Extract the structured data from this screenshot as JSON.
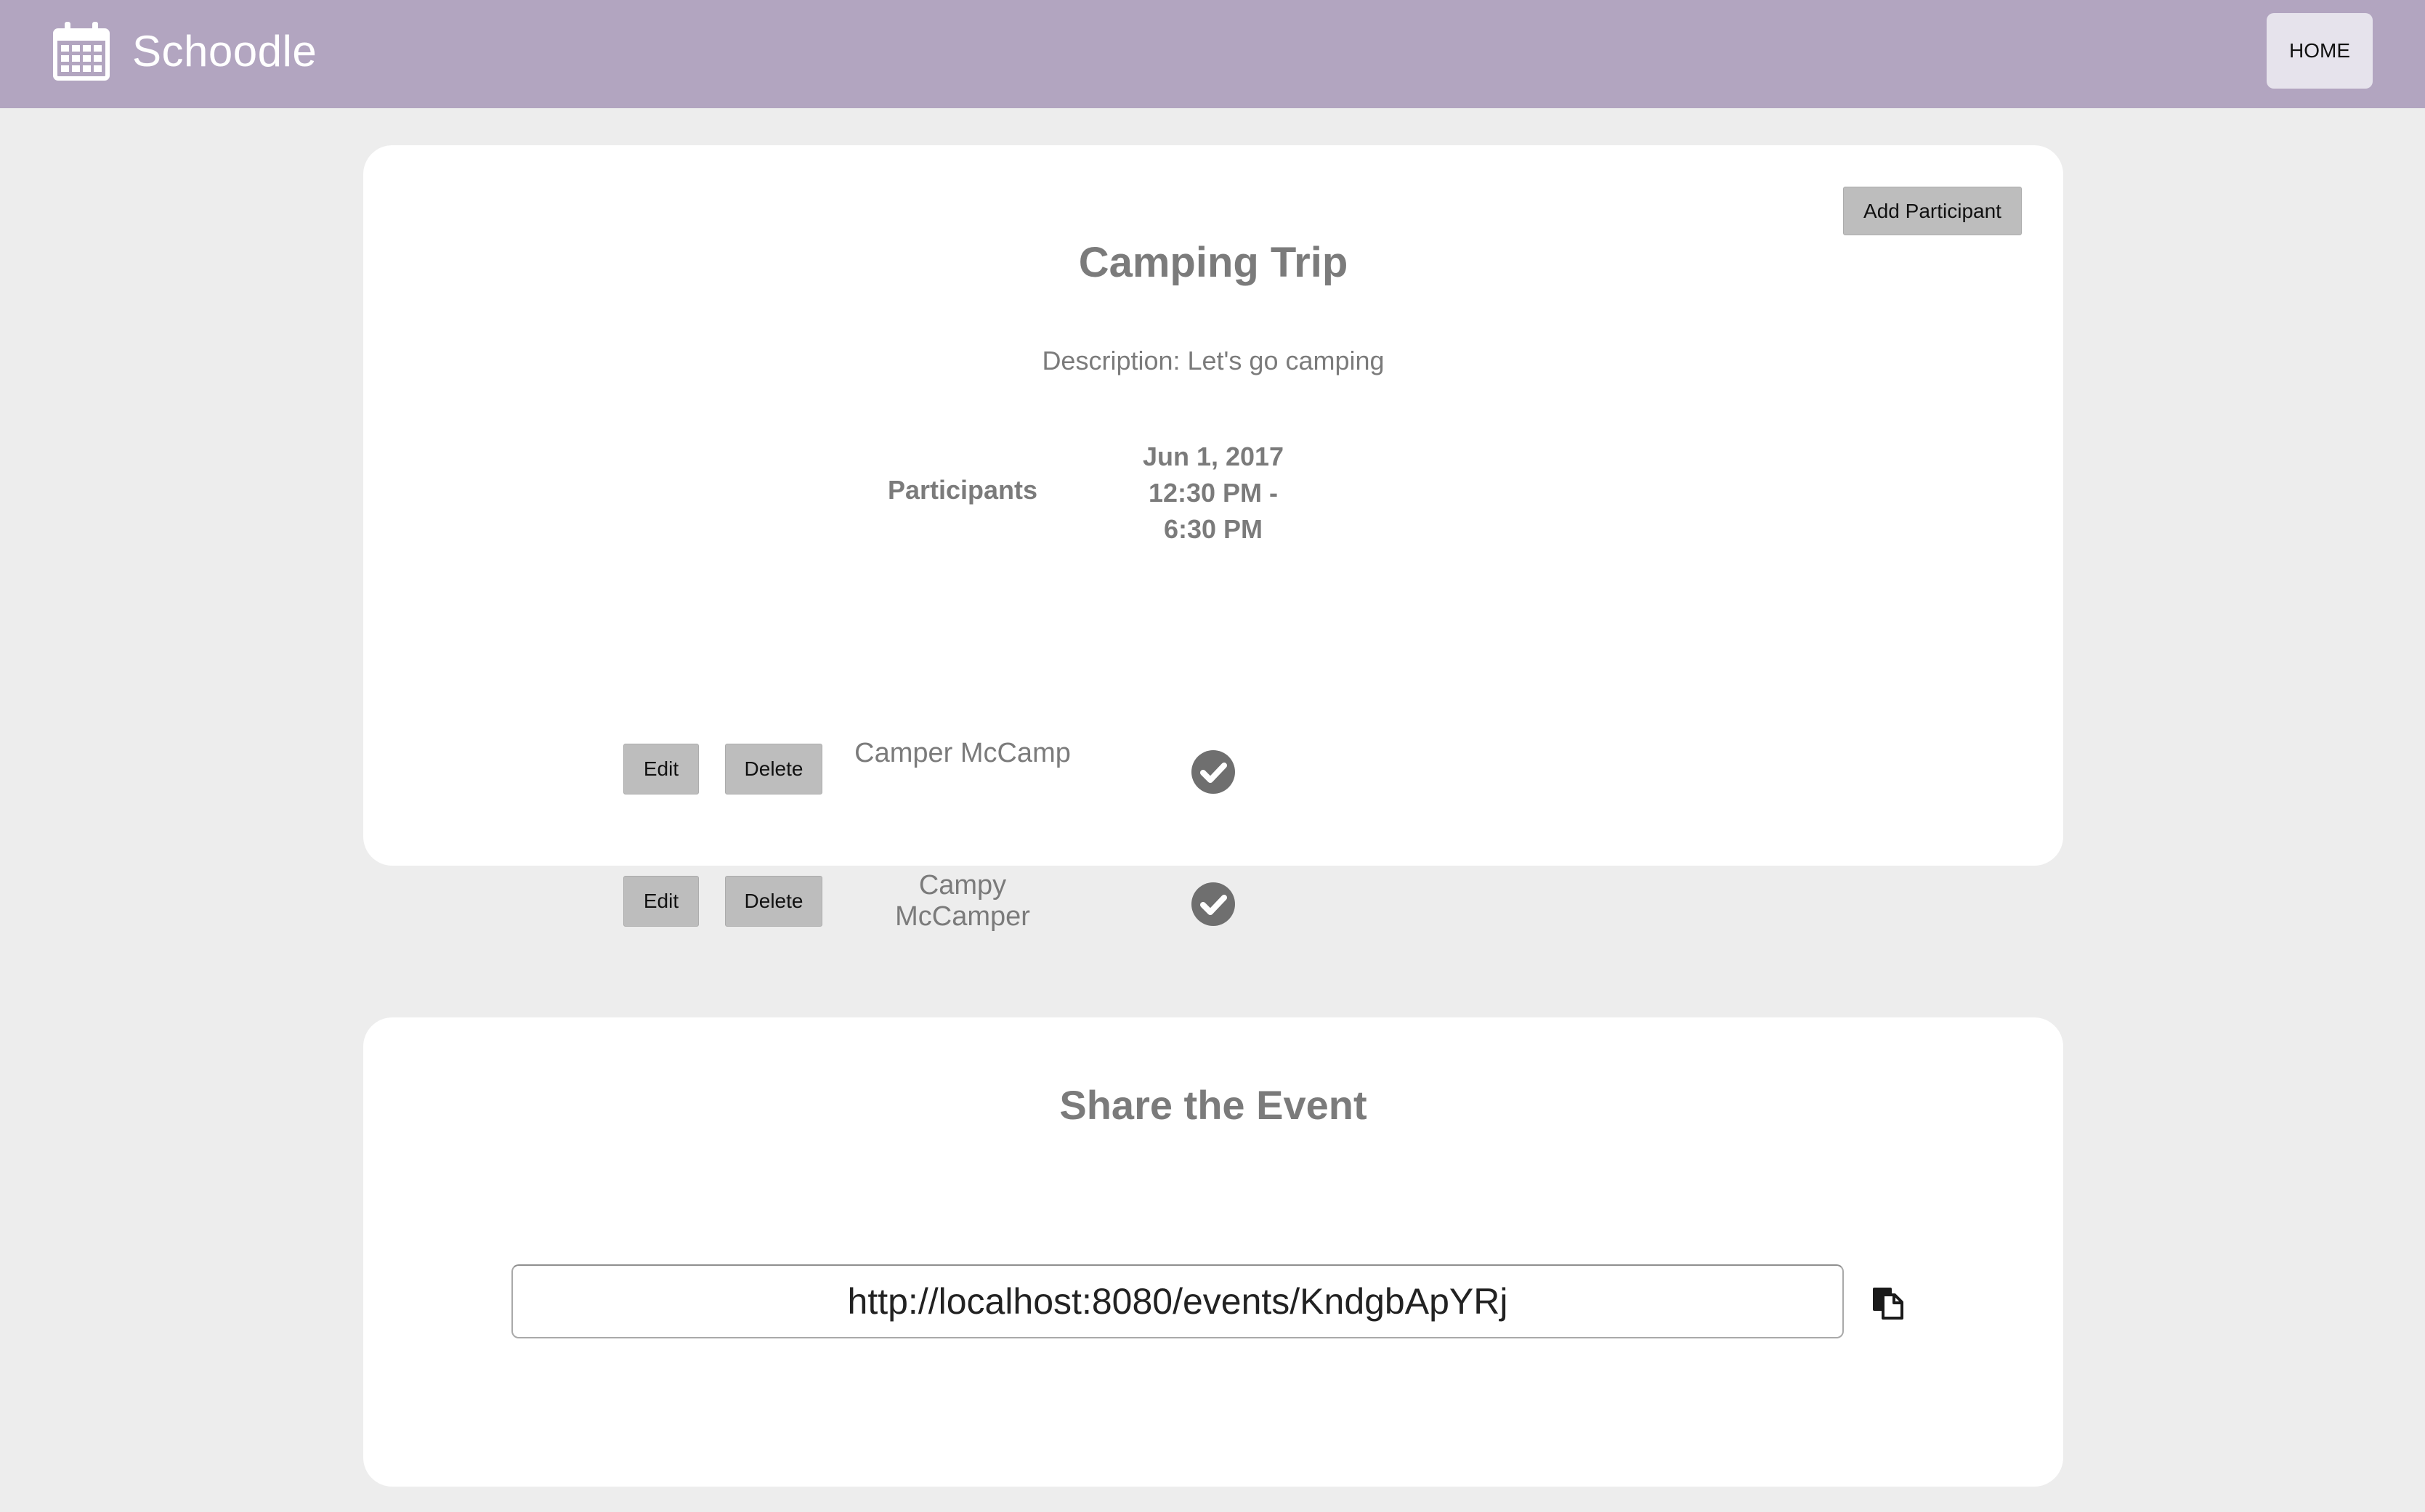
{
  "app": {
    "name": "Schoodle",
    "logo_icon": "calendar-icon",
    "home_label": "HOME"
  },
  "colors": {
    "topbar": "#b2a5c0",
    "background": "#ededed",
    "card": "#ffffff",
    "button": "#bdbdbd",
    "text_muted": "#7b7b7b"
  },
  "event": {
    "add_participant_label": "Add Participant",
    "title": "Camping Trip",
    "description": "Description: Let's go camping",
    "participants_header": "Participants",
    "timeslot": {
      "date": "Jun 1, 2017",
      "start": "12:30 PM -",
      "end": "6:30 PM"
    },
    "participants": [
      {
        "name": "Camper McCamp",
        "edit_label": "Edit",
        "delete_label": "Delete",
        "available": true,
        "status_icon": "check-circle-icon"
      },
      {
        "name": "Campy McCamper",
        "edit_label": "Edit",
        "delete_label": "Delete",
        "available": true,
        "status_icon": "check-circle-icon"
      }
    ]
  },
  "share": {
    "title": "Share the Event",
    "url": "http://localhost:8080/events/KndgbApYRj",
    "copy_icon": "copy-icon"
  }
}
